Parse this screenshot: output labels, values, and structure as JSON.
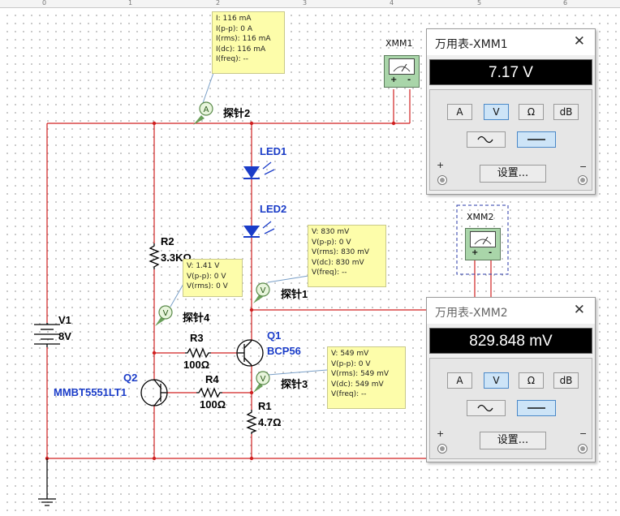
{
  "ruler": {
    "marks": [
      "0",
      "1",
      "2",
      "3",
      "4",
      "5",
      "6"
    ]
  },
  "components": {
    "v1": {
      "name": "V1",
      "value": "8V"
    },
    "r2": {
      "name": "R2",
      "value": "3.3KΩ"
    },
    "r3": {
      "name": "R3",
      "value": "100Ω"
    },
    "r4": {
      "name": "R4",
      "value": "100Ω"
    },
    "r1": {
      "name": "R1",
      "value": "4.7Ω"
    },
    "q1": {
      "name": "Q1",
      "value": "BCP56"
    },
    "q2": {
      "name": "Q2",
      "value": "MMBT5551LT1"
    },
    "led1": {
      "name": "LED1"
    },
    "led2": {
      "name": "LED2"
    }
  },
  "probes": {
    "probe1": {
      "label": "探针1",
      "symbol": "V"
    },
    "probe2": {
      "label": "探针2",
      "symbol": "A"
    },
    "probe3": {
      "label": "探针3",
      "symbol": "V"
    },
    "probe4": {
      "label": "探针4",
      "symbol": "V"
    }
  },
  "tooltips": {
    "probe2": [
      "I: 116 mA",
      "I(p-p): 0 A",
      "I(rms): 116 mA",
      "I(dc): 116 mA",
      "I(freq): --"
    ],
    "probe1": [
      "V: 830 mV",
      "V(p-p): 0 V",
      "V(rms): 830 mV",
      "V(dc): 830 mV",
      "V(freq): --"
    ],
    "probe4": [
      "V: 1.41 V",
      "V(p-p): 0 V",
      "V(rms): 0 V"
    ],
    "probe3": [
      "V: 549 mV",
      "V(p-p): 0 V",
      "V(rms): 549 mV",
      "V(dc): 549 mV",
      "V(freq): --"
    ]
  },
  "xmm_icons": {
    "xmm1": {
      "name": "XMM1",
      "plus": "+",
      "minus": "-"
    },
    "xmm2": {
      "name": "XMM2",
      "plus": "+",
      "minus": "-"
    }
  },
  "dmm1": {
    "title": "万用表-XMM1",
    "close": "✕",
    "reading": "7.17 V",
    "buttons": {
      "amp": "A",
      "volt": "V",
      "ohm": "Ω",
      "db": "dB"
    },
    "selected_mode": "V",
    "selected_signal": "DC",
    "settings": "设置...",
    "plus": "+",
    "minus": "−"
  },
  "dmm2": {
    "title": "万用表-XMM2",
    "close": "✕",
    "reading": "829.848 mV",
    "buttons": {
      "amp": "A",
      "volt": "V",
      "ohm": "Ω",
      "db": "dB"
    },
    "selected_mode": "V",
    "selected_signal": "DC",
    "settings": "设置...",
    "plus": "+",
    "minus": "−"
  },
  "colors": {
    "wire": "#d02020",
    "accent": "#1a3cc8",
    "tooltip": "#fdfdaa",
    "display": "#000000"
  }
}
